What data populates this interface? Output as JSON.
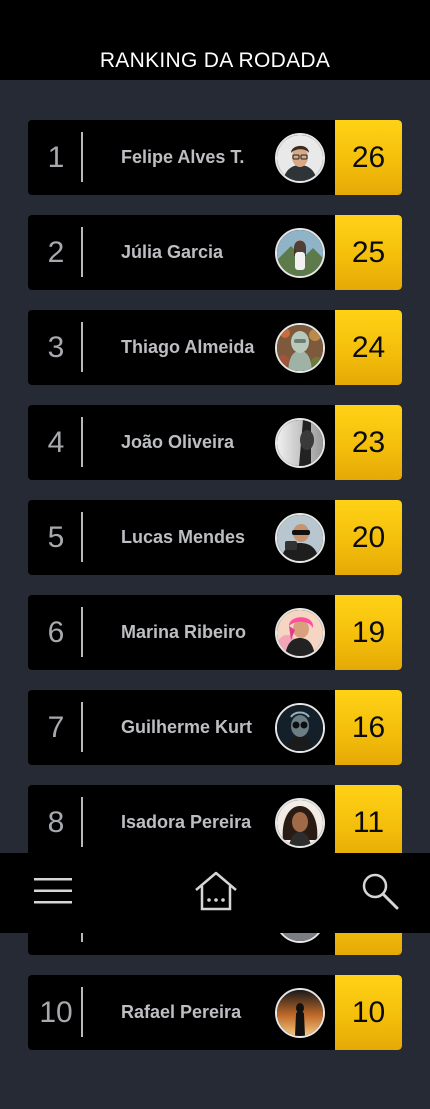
{
  "header": {
    "title": "RANKING DA RODADA"
  },
  "ranking": [
    {
      "rank": "1",
      "name": "Felipe Alves T.",
      "score": "26",
      "avatar": "avatar-felipe"
    },
    {
      "rank": "2",
      "name": "Júlia Garcia",
      "score": "25",
      "avatar": "avatar-julia"
    },
    {
      "rank": "3",
      "name": "Thiago Almeida",
      "score": "24",
      "avatar": "avatar-thiago"
    },
    {
      "rank": "4",
      "name": "João Oliveira",
      "score": "23",
      "avatar": "avatar-joao"
    },
    {
      "rank": "5",
      "name": "Lucas Mendes",
      "score": "20",
      "avatar": "avatar-lucas"
    },
    {
      "rank": "6",
      "name": "Marina Ribeiro",
      "score": "19",
      "avatar": "avatar-marina"
    },
    {
      "rank": "7",
      "name": "Guilherme Kurt",
      "score": "16",
      "avatar": "avatar-guilherme"
    },
    {
      "rank": "8",
      "name": "Isadora Pereira",
      "score": "11",
      "avatar": "avatar-isadora"
    },
    {
      "rank": "",
      "name": "",
      "score": "",
      "avatar": "avatar-hidden"
    },
    {
      "rank": "10",
      "name": "Rafael Pereira",
      "score": "10",
      "avatar": "avatar-rafael"
    }
  ],
  "bottom_nav": {
    "menu_icon": "menu-icon",
    "home_icon": "home-icon",
    "search_icon": "search-icon"
  },
  "colors": {
    "background": "#262a34",
    "card": "#000000",
    "score_accent": "#f5c20d",
    "text_muted": "#bdbec2"
  }
}
